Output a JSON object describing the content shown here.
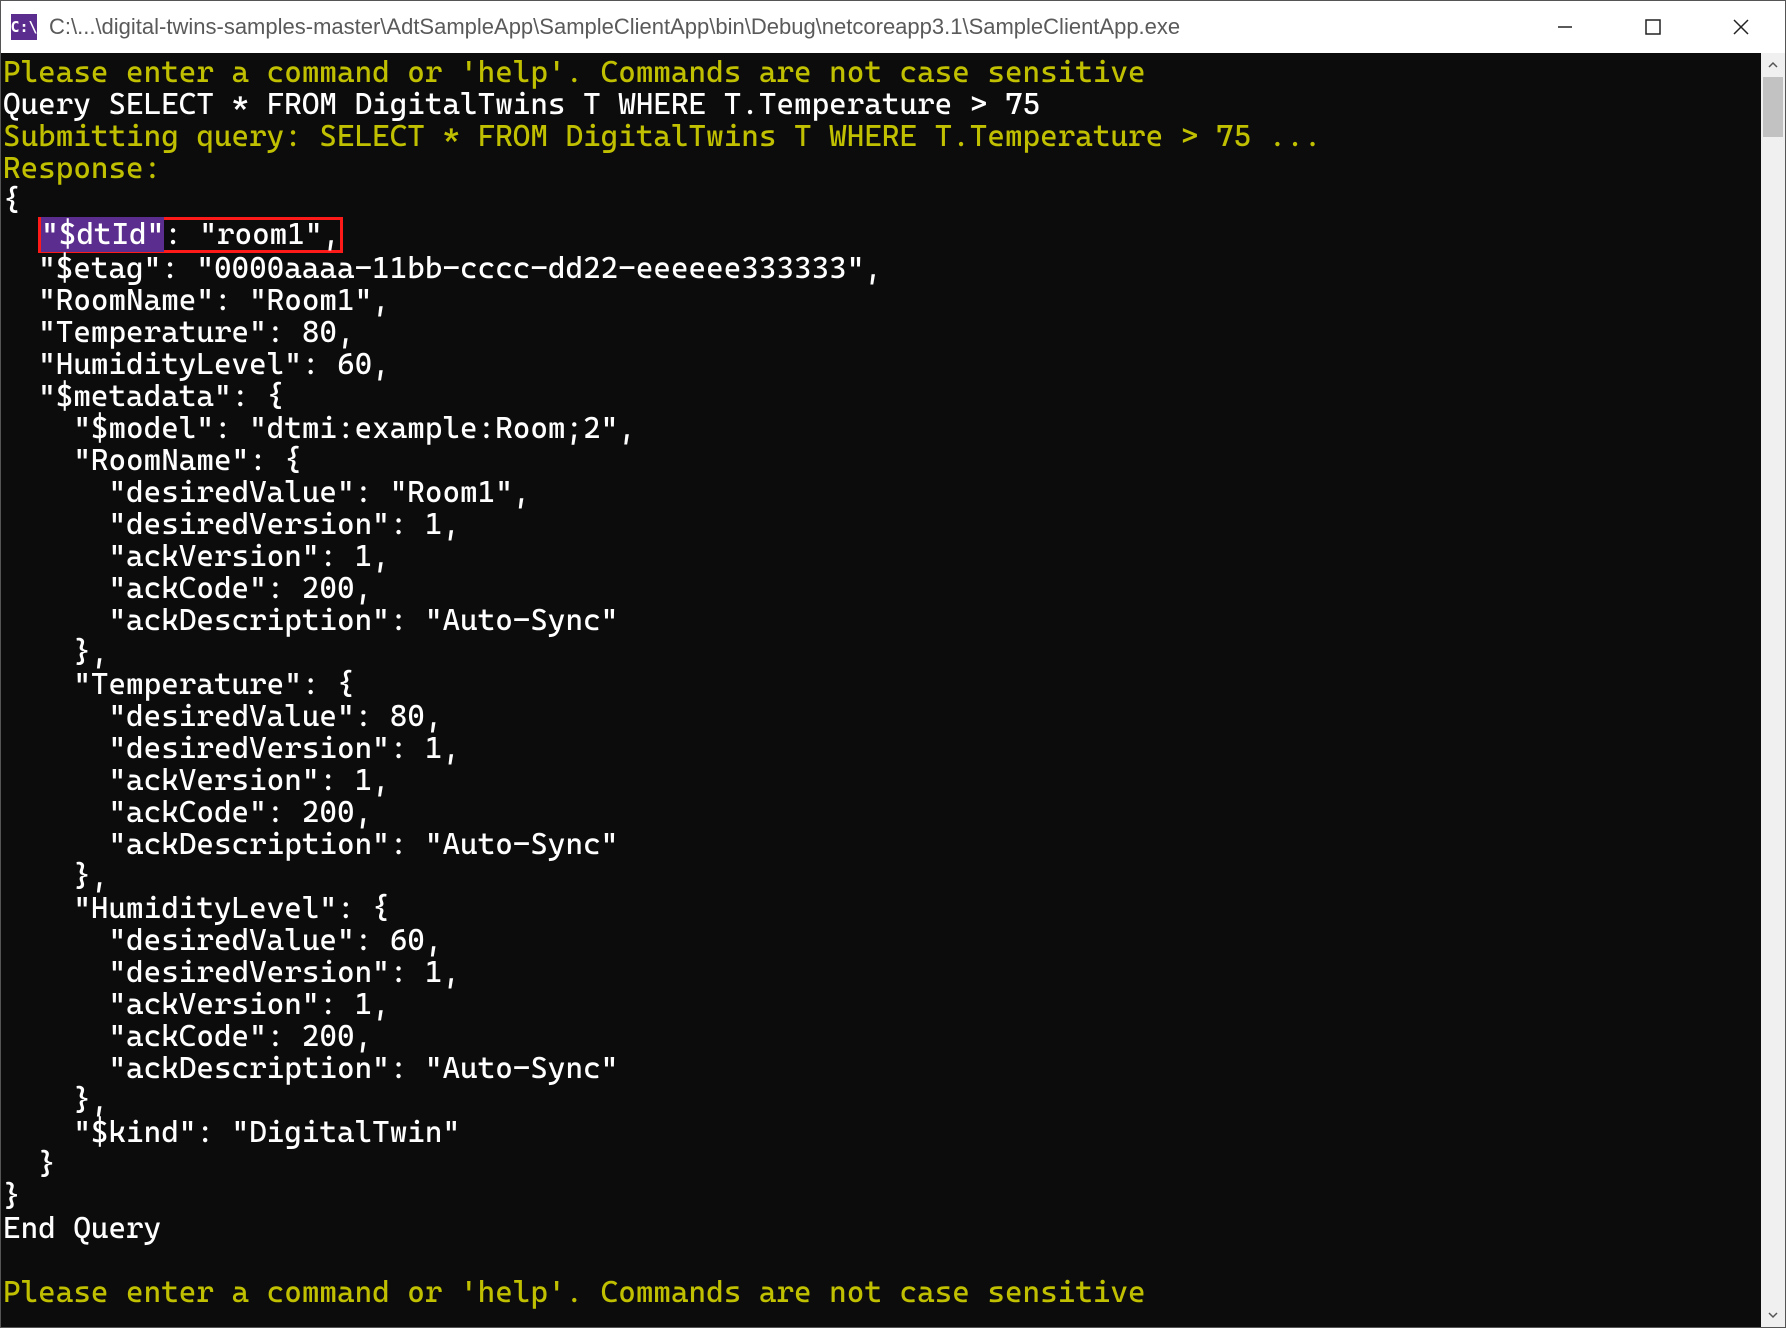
{
  "titlebar": {
    "icon_label": "C:\\",
    "path": "C:\\...\\digital-twins-samples-master\\AdtSampleApp\\SampleClientApp\\bin\\Debug\\netcoreapp3.1\\SampleClientApp.exe"
  },
  "console": {
    "prompt1": "Please enter a command or 'help'. Commands are not case sensitive",
    "query_line": "Query SELECT * FROM DigitalTwins T WHERE T.Temperature > 75",
    "submitting": "Submitting query: SELECT * FROM DigitalTwins T WHERE T.Temperature > 75 ...",
    "response_label": "Response:",
    "brace_open": "{",
    "dtid_key": "\"$dtId\"",
    "dtid_rest": ": \"room1\",",
    "etag_line": "  \"$etag\": \"0000aaaa-11bb-cccc-dd22-eeeeee333333\",",
    "roomname_line": "  \"RoomName\": \"Room1\",",
    "temperature_line": "  \"Temperature\": 80,",
    "humidity_line": "  \"HumidityLevel\": 60,",
    "metadata_open": "  \"$metadata\": {",
    "model_line": "    \"$model\": \"dtmi:example:Room;2\",",
    "rn_open": "    \"RoomName\": {",
    "rn_dv": "      \"desiredValue\": \"Room1\",",
    "rn_dver": "      \"desiredVersion\": 1,",
    "rn_ackv": "      \"ackVersion\": 1,",
    "rn_ackc": "      \"ackCode\": 200,",
    "rn_ackd": "      \"ackDescription\": \"Auto-Sync\"",
    "rn_close": "    },",
    "t_open": "    \"Temperature\": {",
    "t_dv": "      \"desiredValue\": 80,",
    "t_dver": "      \"desiredVersion\": 1,",
    "t_ackv": "      \"ackVersion\": 1,",
    "t_ackc": "      \"ackCode\": 200,",
    "t_ackd": "      \"ackDescription\": \"Auto-Sync\"",
    "t_close": "    },",
    "h_open": "    \"HumidityLevel\": {",
    "h_dv": "      \"desiredValue\": 60,",
    "h_dver": "      \"desiredVersion\": 1,",
    "h_ackv": "      \"ackVersion\": 1,",
    "h_ackc": "      \"ackCode\": 200,",
    "h_ackd": "      \"ackDescription\": \"Auto-Sync\"",
    "h_close": "    },",
    "kind_line": "    \"$kind\": \"DigitalTwin\"",
    "metadata_close": "  }",
    "brace_close": "}",
    "end_query": "End Query",
    "blank": "",
    "prompt2": "Please enter a command or 'help'. Commands are not case sensitive"
  }
}
